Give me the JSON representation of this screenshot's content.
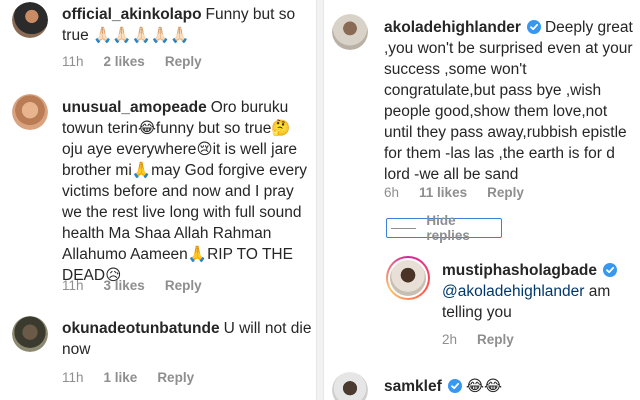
{
  "left": {
    "comments": [
      {
        "username": "official_akinkolapo",
        "text": "Funny but so true 🙏🏻🙏🏻🙏🏻🙏🏻🙏🏻",
        "time": "11h",
        "likes": "2 likes",
        "reply": "Reply"
      },
      {
        "username": "unusual_amopeade",
        "text": "Oro buruku towun terin😂funny but so true🤔 oju aye everywhere😢it is well jare brother mi🙏may God forgive every victims before and now and I pray we the rest live long with full sound health Ma Shaa Allah Rahman Allahumo Aameen🙏RIP TO THE DEAD😥",
        "time": "11h",
        "likes": "3 likes",
        "reply": "Reply"
      },
      {
        "username": "okunadeotunbatunde",
        "text": "U will not die now",
        "time": "11h",
        "likes": "1 like",
        "reply": "Reply"
      }
    ]
  },
  "right": {
    "main_comment": {
      "username": "akoladehighlander",
      "text": "Deeply great ,you won't be surprised even at your success ,some won't congratulate,but pass bye ,wish people good,show them love,not until they pass away,rubbish epistle for them -las las ,the earth is for d lord -we all be sand",
      "time": "6h",
      "likes": "11 likes",
      "reply": "Reply"
    },
    "hide_replies": "Hide replies",
    "reply_comment": {
      "username": "mustiphasholagbade",
      "mention": "@akoladehighlander",
      "text": "am telling you",
      "time": "2h",
      "reply": "Reply"
    },
    "next_comment": {
      "username": "samklef",
      "text": "😂😂"
    }
  },
  "colors": {
    "verified_blue": "#3897f0",
    "meta_gray": "#8e8e8e",
    "mention_blue": "#00376b",
    "focus_outline": "#3b82d6"
  }
}
